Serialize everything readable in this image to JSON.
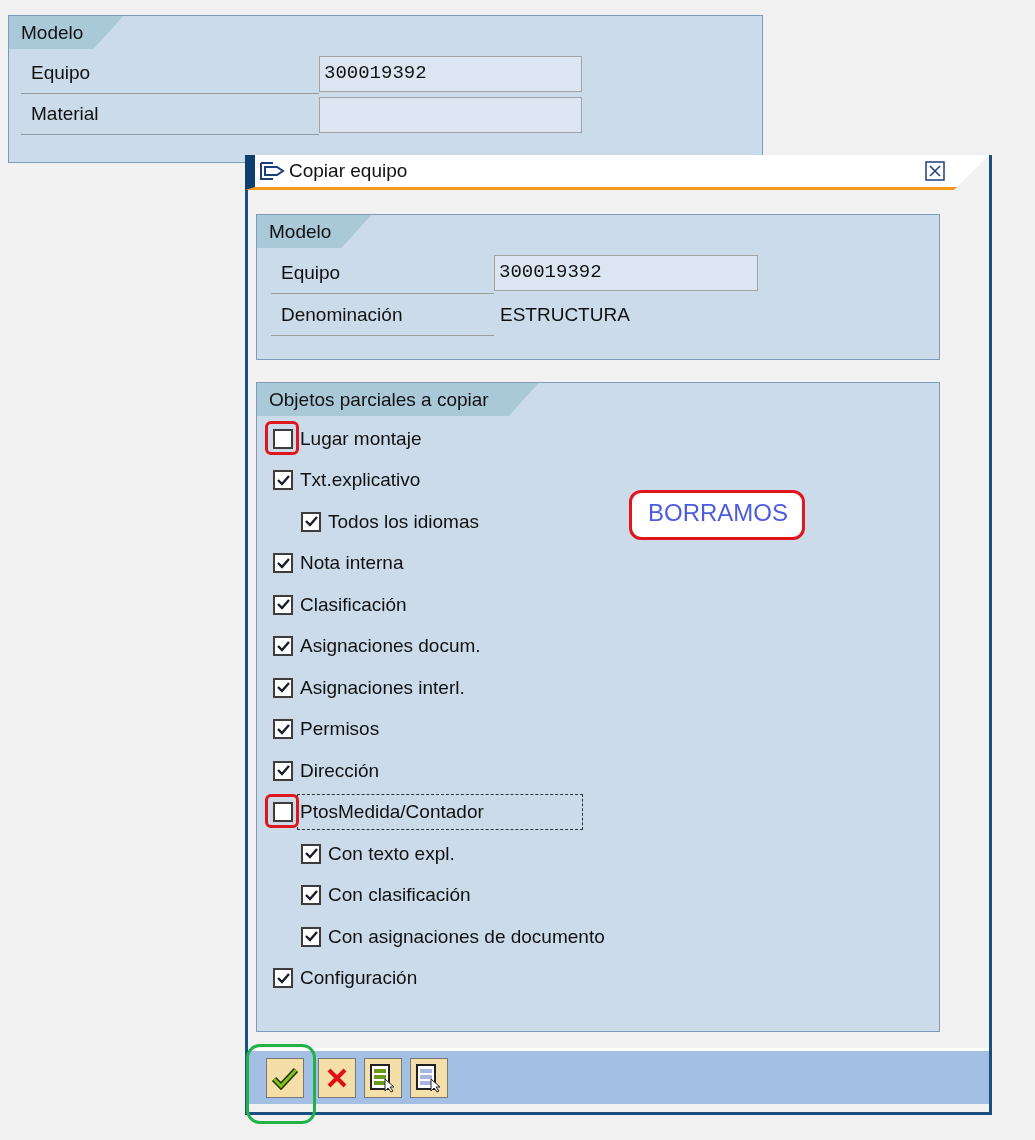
{
  "background_panel": {
    "group_title": "Modelo",
    "fields": [
      {
        "label": "Equipo",
        "value": "300019392"
      },
      {
        "label": "Material"
      }
    ]
  },
  "dialog": {
    "title": "Copiar equipo",
    "model_group": {
      "title": "Modelo",
      "rows": [
        {
          "kind": "field",
          "label": "Equipo",
          "value": "300019392"
        },
        {
          "kind": "text",
          "label": "Denominación",
          "value": "ESTRUCTURA"
        }
      ]
    },
    "options_group": {
      "title": "Objetos parciales a copiar",
      "options": [
        {
          "label": "Lugar montaje",
          "checked": false,
          "highlighted": true,
          "focused": false
        },
        {
          "label": "Txt.explicativo",
          "checked": true,
          "highlighted": false,
          "focused": false,
          "children": [
            {
              "label": "Todos los idiomas",
              "checked": true,
              "highlighted": false,
              "focused": false
            }
          ]
        },
        {
          "label": "Nota interna",
          "checked": true,
          "highlighted": false,
          "focused": false
        },
        {
          "label": "Clasificación",
          "checked": true,
          "highlighted": false,
          "focused": false
        },
        {
          "label": "Asignaciones docum.",
          "checked": true,
          "highlighted": false,
          "focused": false
        },
        {
          "label": "Asignaciones interl.",
          "checked": true,
          "highlighted": false,
          "focused": false
        },
        {
          "label": "Permisos",
          "checked": true,
          "highlighted": false,
          "focused": false
        },
        {
          "label": "Dirección",
          "checked": true,
          "highlighted": false,
          "focused": false
        },
        {
          "label": "PtosMedida/Contador",
          "checked": false,
          "highlighted": true,
          "focused": true,
          "children": [
            {
              "label": "Con texto expl.",
              "checked": true,
              "highlighted": false,
              "focused": false
            },
            {
              "label": "Con clasificación",
              "checked": true,
              "highlighted": false,
              "focused": false
            },
            {
              "label": "Con asignaciones de documento",
              "checked": true,
              "highlighted": false,
              "focused": false
            }
          ]
        },
        {
          "label": "Configuración",
          "checked": true,
          "highlighted": false,
          "focused": false
        }
      ],
      "annotation": {
        "text": "BORRAMOS"
      }
    },
    "buttons": [
      {
        "kind": "confirm",
        "highlighted": true
      },
      {
        "kind": "cancel",
        "highlighted": false
      },
      {
        "kind": "select-all",
        "highlighted": false
      },
      {
        "kind": "deselect-all",
        "highlighted": false
      }
    ]
  }
}
